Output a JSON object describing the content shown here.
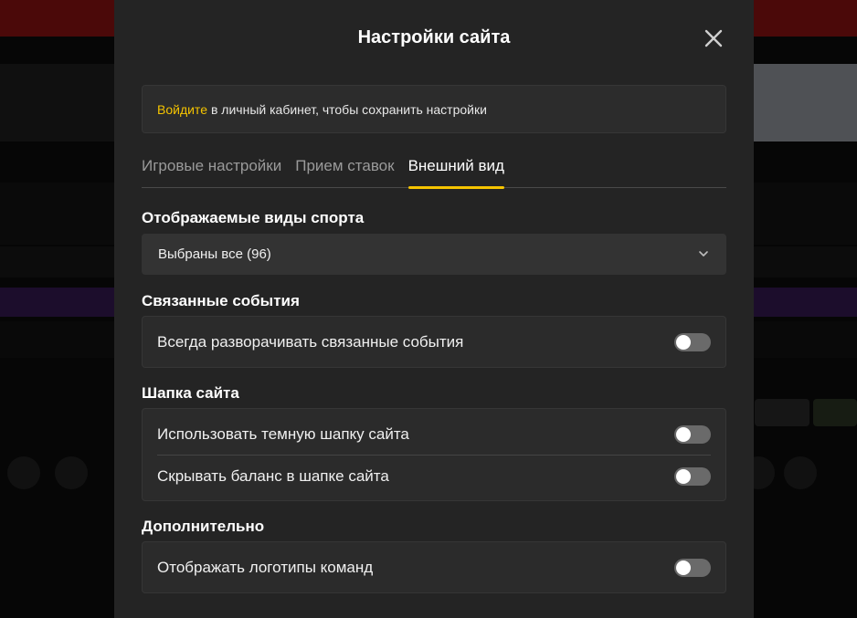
{
  "modal": {
    "title": "Настройки сайта"
  },
  "notice": {
    "link": "Войдите",
    "text": "в личный кабинет, чтобы сохранить настройки"
  },
  "tabs": [
    {
      "label": "Игровые настройки",
      "active": false
    },
    {
      "label": "Прием ставок",
      "active": false
    },
    {
      "label": "Внешний вид",
      "active": true
    }
  ],
  "sports": {
    "title": "Отображаемые виды спорта",
    "selected": "Выбраны все (96)"
  },
  "related": {
    "title": "Связанные события",
    "items": [
      {
        "label": "Всегда разворачивать связанные события",
        "enabled": false
      }
    ]
  },
  "header_section": {
    "title": "Шапка сайта",
    "items": [
      {
        "label": "Использовать темную шапку сайта",
        "enabled": false
      },
      {
        "label": "Скрывать баланс в шапке сайта",
        "enabled": false
      }
    ]
  },
  "extra": {
    "title": "Дополнительно",
    "items": [
      {
        "label": "Отображать логотипы команд",
        "enabled": false
      }
    ]
  },
  "colors": {
    "accent": "#f5c400",
    "modal_bg": "#242424",
    "toggle_off": "#6a6a6a"
  }
}
